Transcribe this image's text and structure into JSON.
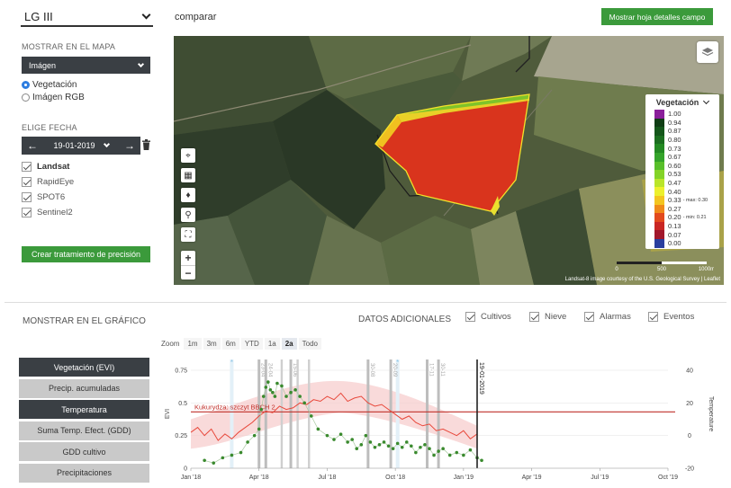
{
  "field": {
    "name": "LG III"
  },
  "map_section": {
    "title": "MOSTRAR EN EL MAPA",
    "layer_select": "Imágen",
    "options": [
      {
        "label": "Vegetación",
        "selected": true
      },
      {
        "label": "Imágen RGB",
        "selected": false
      }
    ]
  },
  "date_section": {
    "title": "ELIGE FECHA",
    "date": "19-01-2019",
    "sources": [
      {
        "label": "Landsat",
        "checked": true
      },
      {
        "label": "RapidEye",
        "checked": true
      },
      {
        "label": "SPOT6",
        "checked": true
      },
      {
        "label": "Sentinel2",
        "checked": true
      }
    ]
  },
  "precision_button": "Crear tratamiento de precisión",
  "compare_link": "comparar",
  "details_button": "Mostrar hoja detalles campo",
  "map": {
    "legend_title": "Vegetación",
    "legend": [
      {
        "value": "1.00",
        "color": "#8a1f9a"
      },
      {
        "value": "0.94",
        "color": "#0f3d14"
      },
      {
        "value": "0.87",
        "color": "#14561a"
      },
      {
        "value": "0.80",
        "color": "#1b6e1f"
      },
      {
        "value": "0.73",
        "color": "#238a22"
      },
      {
        "value": "0.67",
        "color": "#34a42a"
      },
      {
        "value": "0.60",
        "color": "#58bf2a"
      },
      {
        "value": "0.53",
        "color": "#83d327"
      },
      {
        "value": "0.47",
        "color": "#b9e52a"
      },
      {
        "value": "0.40",
        "color": "#ecf02d",
        "note": ""
      },
      {
        "value": "0.33",
        "color": "#f3c51f",
        "note": "- max: 0.30"
      },
      {
        "value": "0.27",
        "color": "#ef8a19"
      },
      {
        "value": "0.20",
        "color": "#e24a1d",
        "note": "- min: 0.21"
      },
      {
        "value": "0.13",
        "color": "#c92623"
      },
      {
        "value": "0.07",
        "color": "#a1172c"
      },
      {
        "value": "0.00",
        "color": "#2a3e9e"
      }
    ],
    "scale_labels": [
      "0",
      "500",
      "1000m"
    ],
    "attribution": "Landsat-8 image courtesy of the U.S. Geological Survey | Leaflet"
  },
  "chart_section": {
    "title": "MONSTRAR EN EL GRÁFICO",
    "additional_title": "DATOS ADICIONALES",
    "additional": [
      {
        "label": "Cultivos",
        "checked": true
      },
      {
        "label": "Nieve",
        "checked": true
      },
      {
        "label": "Alarmas",
        "checked": true
      },
      {
        "label": "Eventos",
        "checked": true
      }
    ],
    "zoom_label": "Zoom",
    "zoom_options": [
      {
        "label": "1m",
        "active": false
      },
      {
        "label": "3m",
        "active": false
      },
      {
        "label": "6m",
        "active": false
      },
      {
        "label": "YTD",
        "active": false
      },
      {
        "label": "1a",
        "active": false
      },
      {
        "label": "2a",
        "active": true
      },
      {
        "label": "Todo",
        "active": false
      }
    ],
    "metrics": [
      {
        "label": "Vegetación (EVI)",
        "active": true
      },
      {
        "label": "Precip. acumuladas",
        "active": false
      },
      {
        "label": "Temperatura",
        "active": true
      },
      {
        "label": "Suma Temp. Efect. (GDD)",
        "active": false
      },
      {
        "label": "GDD cultivo",
        "active": false
      },
      {
        "label": "Precipitaciones",
        "active": false
      }
    ]
  },
  "chart_data": {
    "type": "line",
    "x_labels": [
      "Jan '18",
      "Apr '18",
      "Jul '18",
      "Oct '18",
      "Jan '19",
      "Apr '19",
      "Jul '19",
      "Oct '19"
    ],
    "left_axis": {
      "label": "EVI",
      "ticks": [
        "0",
        "0.25",
        "0.5",
        "0.75"
      ],
      "range": [
        0,
        0.75
      ]
    },
    "right_axis": {
      "label": "Temperature",
      "ticks": [
        "-20",
        "0",
        "20",
        "40"
      ],
      "range": [
        -20,
        40
      ]
    },
    "crop_label": "Kukurydza: szczyt BBCH 2",
    "current_date_label": "19-01-2019",
    "event_labels": [
      "23-04",
      "24-04",
      "15-06",
      "30-08",
      "20-09",
      "17-11",
      "30-11"
    ],
    "color_temperature": "#e8473a",
    "color_evi": "#3a8a2e",
    "color_threshold": "#c0302a",
    "series": [
      {
        "name": "EVI",
        "x_month": [
          0.6,
          1.0,
          1.4,
          1.8,
          2.2,
          2.5,
          2.8,
          3.0,
          3.1,
          3.2,
          3.3,
          3.4,
          3.5,
          3.6,
          3.7,
          3.8,
          4.0,
          4.2,
          4.4,
          4.6,
          4.8,
          5.0,
          5.3,
          5.6,
          6.0,
          6.3,
          6.6,
          6.9,
          7.1,
          7.3,
          7.5,
          7.7,
          7.9,
          8.1,
          8.3,
          8.5,
          8.7,
          8.9,
          9.1,
          9.3,
          9.5,
          9.7,
          9.9,
          10.1,
          10.3,
          10.5,
          10.7,
          10.9,
          11.1,
          11.4,
          11.7,
          12.0,
          12.3,
          12.6,
          12.8
        ],
        "values": [
          0.06,
          0.04,
          0.08,
          0.1,
          0.12,
          0.2,
          0.25,
          0.3,
          0.45,
          0.55,
          0.62,
          0.66,
          0.6,
          0.58,
          0.55,
          0.65,
          0.63,
          0.55,
          0.58,
          0.6,
          0.55,
          0.5,
          0.4,
          0.3,
          0.25,
          0.22,
          0.26,
          0.2,
          0.22,
          0.15,
          0.18,
          0.25,
          0.2,
          0.16,
          0.18,
          0.2,
          0.17,
          0.15,
          0.19,
          0.16,
          0.2,
          0.17,
          0.12,
          0.16,
          0.18,
          0.15,
          0.1,
          0.13,
          0.15,
          0.1,
          0.12,
          0.1,
          0.14,
          0.08,
          0.06
        ]
      },
      {
        "name": "Temperature",
        "x_month": [
          0.0,
          0.3,
          0.6,
          0.9,
          1.2,
          1.5,
          1.8,
          2.1,
          2.4,
          2.7,
          3.0,
          3.3,
          3.6,
          3.9,
          4.2,
          4.5,
          4.8,
          5.1,
          5.4,
          5.7,
          6.0,
          6.3,
          6.6,
          6.9,
          7.2,
          7.5,
          7.8,
          8.1,
          8.4,
          8.7,
          9.0,
          9.3,
          9.6,
          9.9,
          10.2,
          10.5,
          10.8,
          11.1,
          11.4,
          11.7,
          12.0,
          12.3,
          12.6
        ],
        "values": [
          2,
          5,
          0,
          4,
          -3,
          1,
          -2,
          2,
          5,
          8,
          12,
          15,
          14,
          18,
          16,
          17,
          20,
          19,
          22,
          21,
          24,
          22,
          26,
          21,
          23,
          24,
          20,
          18,
          19,
          16,
          13,
          10,
          12,
          8,
          6,
          7,
          3,
          4,
          2,
          0,
          3,
          -2,
          1
        ]
      }
    ]
  }
}
